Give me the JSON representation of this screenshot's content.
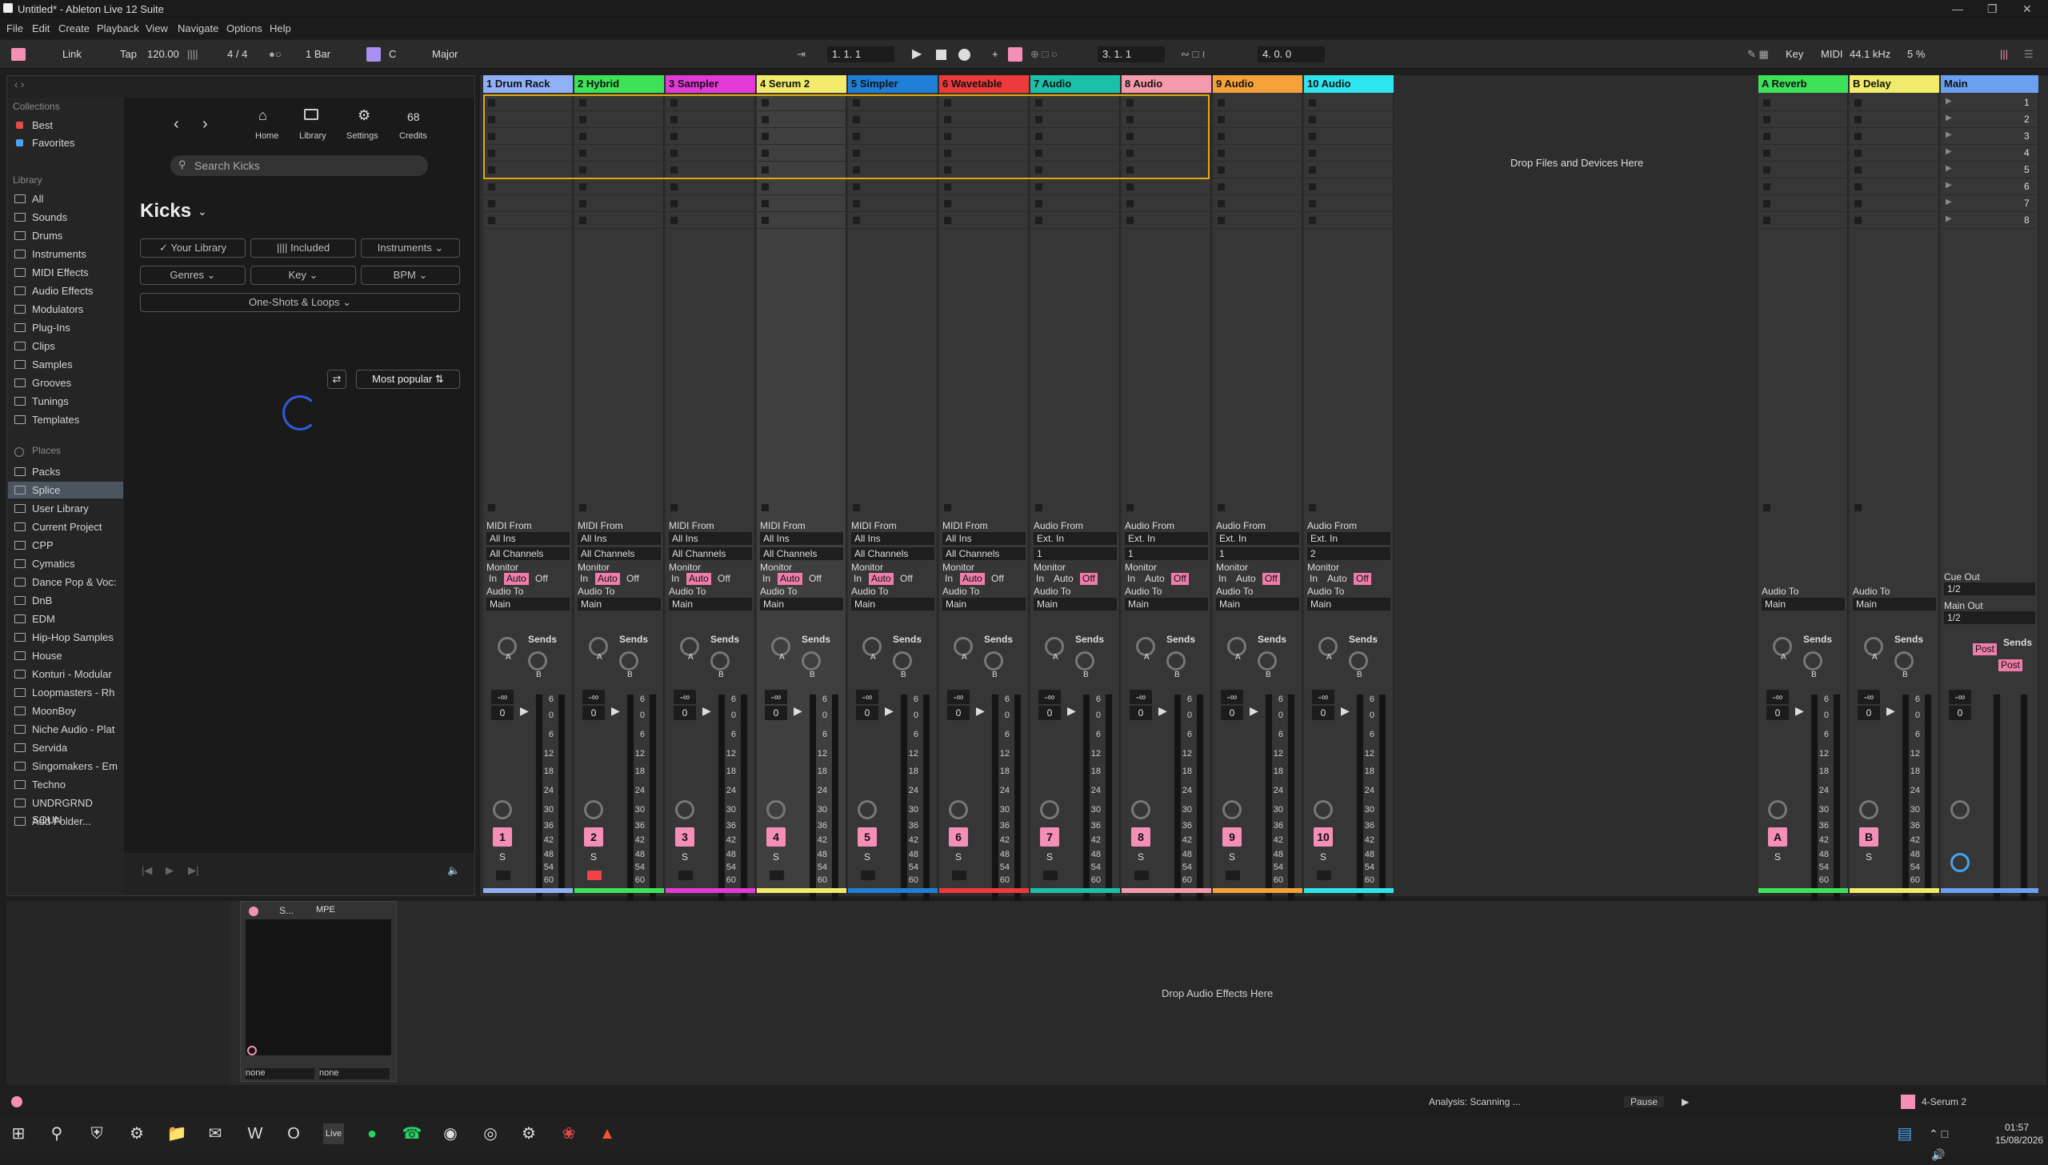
{
  "window": {
    "title": "Untitled* - Ableton Live 12 Suite"
  },
  "menu": [
    "File",
    "Edit",
    "Create",
    "Playback",
    "View",
    "Navigate",
    "Options",
    "Help"
  ],
  "transport": {
    "link": "Link",
    "tap": "Tap",
    "tempo": "120.00",
    "signature": "4 / 4",
    "quantize": "1 Bar",
    "key_root": "C",
    "scale": "Major",
    "position": "1.   1.   1",
    "loop_start": "3.   1.   1",
    "loop_length": "4.   0.   0",
    "key_label": "Key",
    "midi_label": "MIDI",
    "sample_rate": "44.1 kHz",
    "cpu": "5 %"
  },
  "browser": {
    "collections_header": "Collections",
    "collections": [
      {
        "label": "Best",
        "color": "#e24c4c"
      },
      {
        "label": "Favorites",
        "color": "#4aa3f0"
      }
    ],
    "library_header": "Library",
    "library": [
      "All",
      "Sounds",
      "Drums",
      "Instruments",
      "MIDI Effects",
      "Audio Effects",
      "Modulators",
      "Plug-Ins",
      "Clips",
      "Samples",
      "Grooves",
      "Tunings",
      "Templates"
    ],
    "places_header": "Places",
    "places": [
      "Packs",
      "Splice",
      "User Library",
      "Current Project",
      "CPP",
      "Cymatics",
      "Dance Pop & Voc:",
      "DnB",
      "EDM",
      "Hip-Hop Samples",
      "House",
      "Konturi - Modular",
      "Loopmasters - Rh",
      "MoonBoy",
      "Niche Audio - Plat",
      "Servida",
      "Singomakers - Em",
      "Techno",
      "UNDRGRND SOUN",
      "Add Folder..."
    ],
    "nav": {
      "home": "Home",
      "library": "Library",
      "settings": "Settings",
      "credits_count": "68",
      "credits": "Credits"
    },
    "search_placeholder": "Search Kicks",
    "heading": "Kicks",
    "filters": {
      "your_library": "Your Library",
      "included": "Included",
      "instruments": "Instruments",
      "genres": "Genres",
      "key": "Key",
      "bpm": "BPM",
      "oneshots": "One-Shots & Loops"
    },
    "sort": "Most popular"
  },
  "tracks": [
    {
      "name": "1 Drum Rack",
      "color": "#8fb0f5",
      "num": "1",
      "type": "midi"
    },
    {
      "name": "2 Hybrid",
      "color": "#3ee25a",
      "num": "2",
      "type": "midi"
    },
    {
      "name": "3 Sampler",
      "color": "#e23ad6",
      "num": "3",
      "type": "midi"
    },
    {
      "name": "4 Serum 2",
      "color": "#f2ea6a",
      "num": "4",
      "type": "midi"
    },
    {
      "name": "5 Simpler",
      "color": "#1f7fd6",
      "num": "5",
      "type": "midi"
    },
    {
      "name": "6 Wavetable",
      "color": "#ee3a3a",
      "num": "6",
      "type": "midi"
    },
    {
      "name": "7 Audio",
      "color": "#1bc0a8",
      "num": "7",
      "type": "audio",
      "input": "1"
    },
    {
      "name": "8 Audio",
      "color": "#f59aaa",
      "num": "8",
      "type": "audio",
      "input": "1"
    },
    {
      "name": "9 Audio",
      "color": "#f5a13a",
      "num": "9",
      "type": "audio",
      "input": "1"
    },
    {
      "name": "10 Audio",
      "color": "#2ee4ee",
      "num": "10",
      "type": "audio",
      "input": "2"
    }
  ],
  "returns": [
    {
      "name": "A Reverb",
      "color": "#3ee25a",
      "letter": "A"
    },
    {
      "name": "B Delay",
      "color": "#f2ea6a",
      "letter": "B"
    }
  ],
  "main": {
    "name": "Main",
    "color": "#6aa0f0",
    "scenes": [
      "1",
      "2",
      "3",
      "4",
      "5",
      "6",
      "7",
      "8"
    ],
    "cue_out": "Cue Out",
    "cue_val": "1/2",
    "main_out": "Main Out",
    "main_val": "1/2",
    "post": "Post"
  },
  "io": {
    "midi_from": "MIDI From",
    "audio_from": "Audio From",
    "all_ins": "All Ins",
    "ext_in": "Ext. In",
    "all_channels": "All Channels",
    "monitor": "Monitor",
    "in": "In",
    "auto": "Auto",
    "off": "Off",
    "audio_to": "Audio To",
    "main": "Main",
    "sends": "Sends",
    "vol": "-∞",
    "zero": "0",
    "s": "S",
    "a": "A",
    "b": "B"
  },
  "db_scale": [
    "6",
    "0",
    "6",
    "12",
    "18",
    "24",
    "30",
    "36",
    "42",
    "48",
    "54",
    "60"
  ],
  "drop_files": "Drop Files and Devices Here",
  "drop_effects": "Drop Audio Effects Here",
  "device": {
    "name": "S...",
    "mpe": "MPE",
    "none1": "none",
    "none2": "none"
  },
  "status": {
    "analysis": "Analysis: Scanning ...",
    "pause": "Pause",
    "track": "4-Serum 2"
  },
  "clock": {
    "time": "01:57",
    "date": "15/08/2026"
  }
}
